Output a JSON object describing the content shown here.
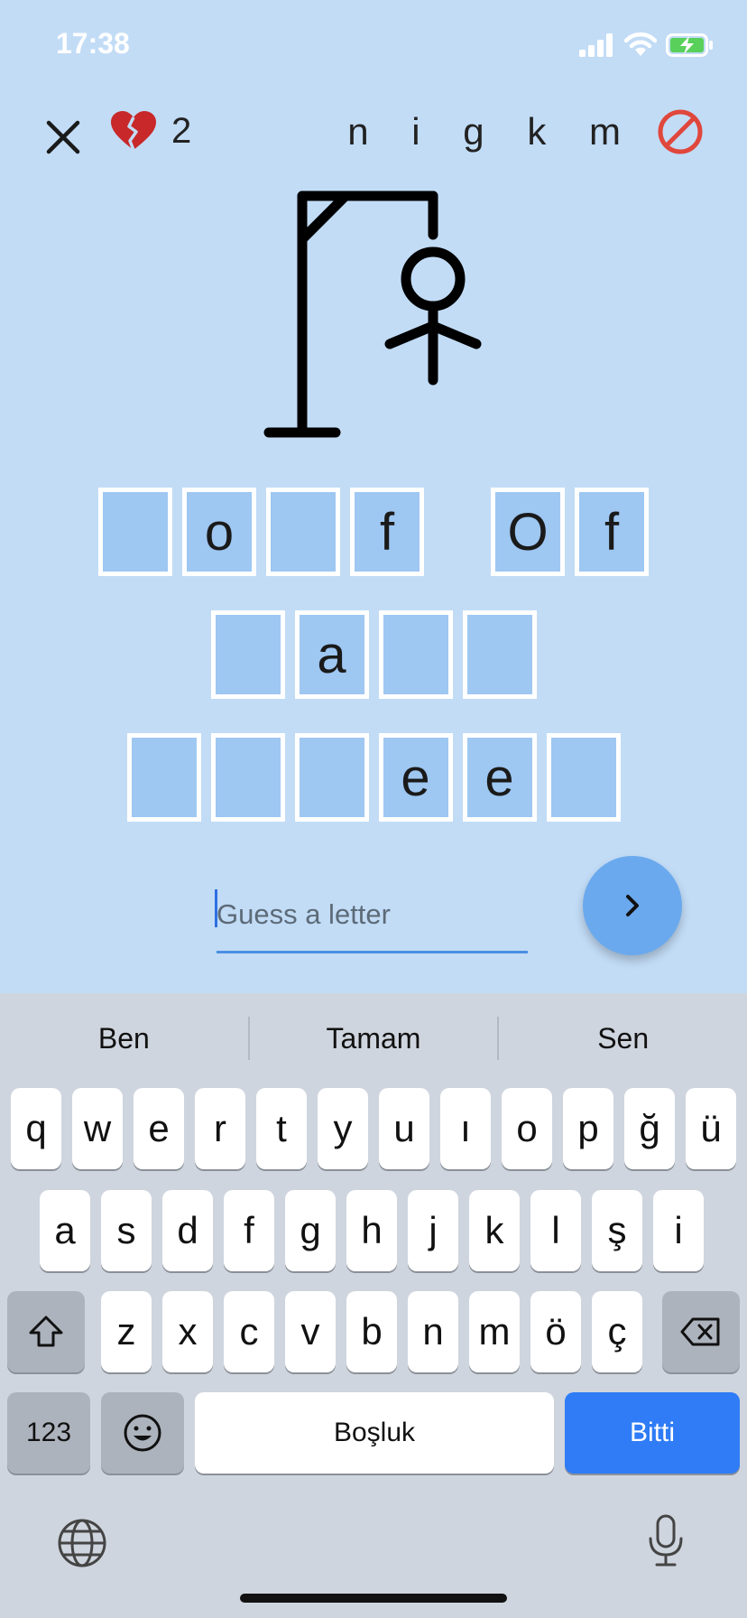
{
  "status": {
    "time": "17:38",
    "icons": [
      "signal-icon",
      "wifi-icon",
      "battery-charging-icon"
    ]
  },
  "header": {
    "lives": "2",
    "missed_letters": "n i g k m"
  },
  "words": {
    "w1": [
      "",
      "o",
      "",
      "f"
    ],
    "w2": [
      "O",
      "f"
    ],
    "w3": [
      "",
      "a",
      "",
      ""
    ],
    "w4": [
      "",
      "",
      "",
      "e",
      "e",
      ""
    ]
  },
  "guess": {
    "placeholder": "Guess a letter",
    "value": ""
  },
  "keyboard": {
    "suggestions": [
      "Ben",
      "Tamam",
      "Sen"
    ],
    "row1": [
      "q",
      "w",
      "e",
      "r",
      "t",
      "y",
      "u",
      "ı",
      "o",
      "p",
      "ğ",
      "ü"
    ],
    "row2": [
      "a",
      "s",
      "d",
      "f",
      "g",
      "h",
      "j",
      "k",
      "l",
      "ş",
      "i"
    ],
    "row3": [
      "z",
      "x",
      "c",
      "v",
      "b",
      "n",
      "m",
      "ö",
      "ç"
    ],
    "numbers_label": "123",
    "space_label": "Boşluk",
    "done_label": "Bitti"
  },
  "colors": {
    "background": "#c2dcf6",
    "tile": "#9ec7f2",
    "accent": "#2f7cf6",
    "danger": "#e0473c"
  }
}
